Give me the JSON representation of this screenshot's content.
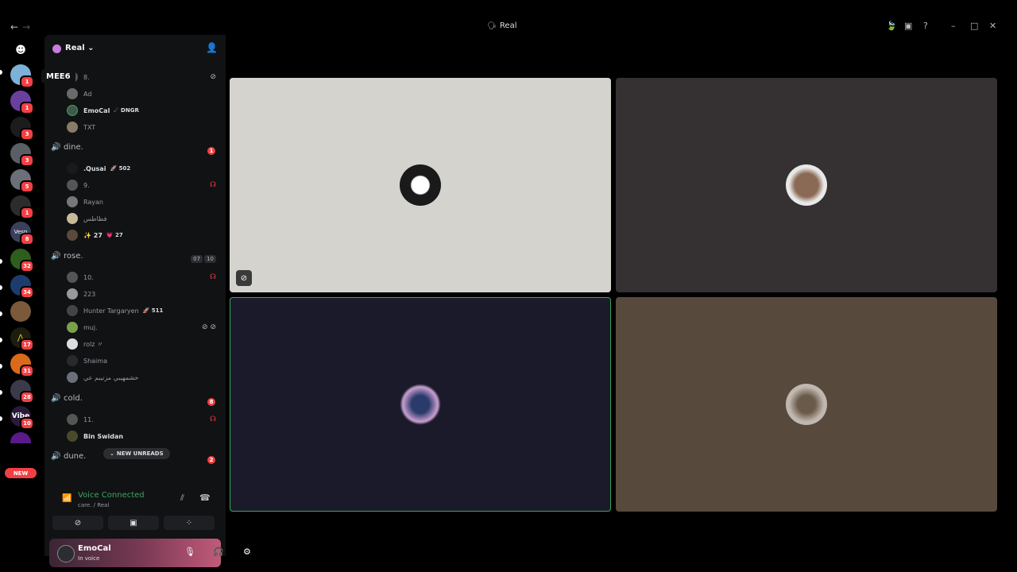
{
  "titlebar": {
    "back": "←",
    "forward": "→",
    "title": "Real",
    "title_icon": "🗣"
  },
  "tooltip": "MEE6",
  "rail": {
    "badges": [
      "1",
      "1",
      "3",
      "3",
      "5",
      "1",
      "8",
      "32",
      "34",
      "17",
      "31",
      "28",
      "10"
    ],
    "new_label": "NEW",
    "labels": {
      "vesper": "Vesp",
      "vibe": "Vibe"
    }
  },
  "sidebar": {
    "server_name": "Real",
    "chevron": "⌄",
    "channels": [
      {
        "name": "dine.",
        "unread": "1"
      },
      {
        "name": "rose.",
        "limit_a": "07",
        "limit_b": "10"
      },
      {
        "name": "cold.",
        "unread": "8"
      },
      {
        "name": "dune.",
        "unread": "2"
      }
    ],
    "users": {
      "u8": "8.",
      "ad": "Ad",
      "emocal": "EmoCal",
      "emocal_badge": "☄ DNGR",
      "txt": "TXT",
      "qusai": ".Qusai",
      "qusai_badge": "🚀 502",
      "u9": "9.",
      "rayan": "Rayan",
      "arabic1": "فطاطس",
      "u27": "✨ 27",
      "u27_badge": "💗 27",
      "u10": "10.",
      "u223": "223",
      "hunter": "Hunter Targaryen",
      "hunter_badge": "🚀 511",
      "muj": "muj.",
      "rolz": "rolz 〃",
      "shaima": "Shaima",
      "arabic2": "خشمهيبي مزنيبم عي",
      "u11": "11.",
      "bin": "Bin Swidan"
    },
    "new_unreads": "NEW UNREADS"
  },
  "voice": {
    "title": "Voice Connected",
    "sub": "care. / Real"
  },
  "user": {
    "name": "EmoCal",
    "status": "In voice"
  },
  "colors": {
    "tile1": "#d4d3ce",
    "tile2": "#353132",
    "tile3": "#1b1a2a",
    "tile4": "#574a3c",
    "green": "#3ba55d",
    "red": "#f23f43"
  }
}
